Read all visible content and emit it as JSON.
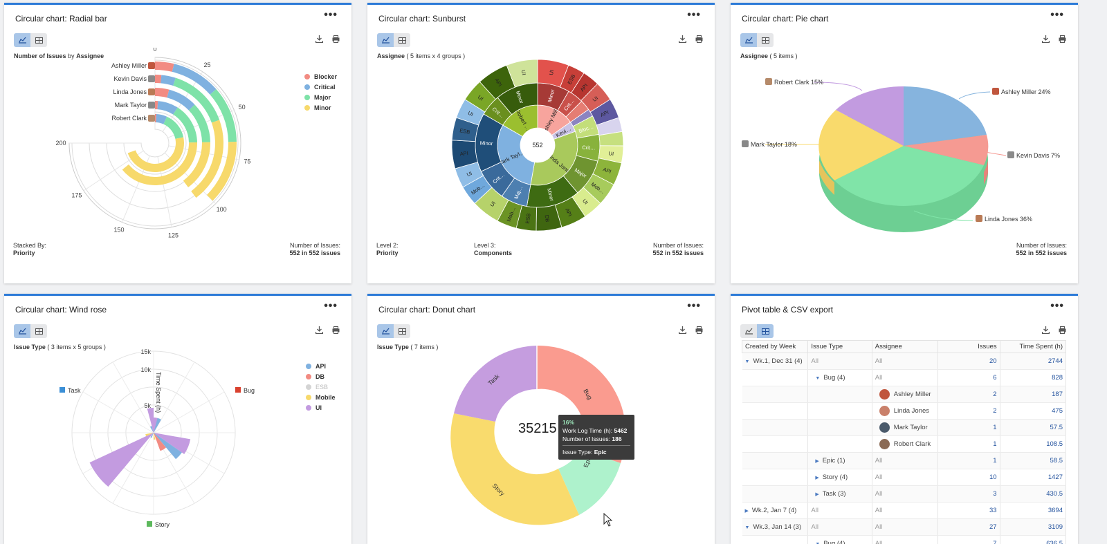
{
  "common": {
    "more": "•••"
  },
  "radial": {
    "title": "Circular chart: Radial bar",
    "subtitle_bold1": "Number of Issues",
    "subtitle_mid": "by",
    "subtitle_bold2": "Assignee",
    "footer_left_label": "Stacked By:",
    "footer_left_value": "Priority",
    "footer_right_label": "Number of Issues:",
    "footer_right_value": "552 in 552 issues",
    "ticks": [
      "0",
      "25",
      "50",
      "75",
      "100",
      "125",
      "150",
      "175",
      "200"
    ],
    "assignees": [
      "Ashley Miller",
      "Kevin Davis",
      "Linda Jones",
      "Mark Taylor",
      "Robert Clark"
    ],
    "legend": [
      {
        "label": "Blocker",
        "color": "#f28b82"
      },
      {
        "label": "Critical",
        "color": "#7fb1e0"
      },
      {
        "label": "Major",
        "color": "#7ee2a8"
      },
      {
        "label": "Minor",
        "color": "#f7d96b"
      }
    ]
  },
  "sunburst": {
    "title": "Circular chart: Sunburst",
    "subtitle_bold": "Assignee",
    "subtitle_rest": "( 5 items x 4 groups )",
    "center": "552",
    "footer1_label": "Level 2:",
    "footer1_value": "Priority",
    "footer2_label": "Level 3:",
    "footer2_value": "Components",
    "footer3_label": "Number of Issues:",
    "footer3_value": "552 in 552 issues",
    "inner": [
      {
        "label": "Ashley Miller",
        "color": "#f7a49d"
      },
      {
        "label": "Kevi…",
        "color": "#c9c3e6"
      },
      {
        "label": "Linda Jones",
        "color": "#a9c95c"
      },
      {
        "label": "Mark Tayl…",
        "color": "#7fb1e0"
      },
      {
        "label": "Robert …",
        "color": "#9bbf2f"
      }
    ],
    "middle": [
      {
        "label": "Minor",
        "color": "#a63a36"
      },
      {
        "label": "Crit…",
        "color": "#c9504a"
      },
      {
        "label": "Blo…",
        "color": "#e57d73"
      },
      {
        "label": "Min…",
        "color": "#8b84c0"
      },
      {
        "label": "Bloc…",
        "color": "#c3de7a"
      },
      {
        "label": "Crit…",
        "color": "#88b23c"
      },
      {
        "label": "Major",
        "color": "#6f9430"
      },
      {
        "label": "Minor",
        "color": "#3e6b12"
      },
      {
        "label": "Maj…",
        "color": "#4d7fb0"
      },
      {
        "label": "Crit…",
        "color": "#3a6a9b"
      },
      {
        "label": "Minor",
        "color": "#1f4e79"
      },
      {
        "label": "Crit…",
        "color": "#6a8f1e"
      },
      {
        "label": "Minor",
        "color": "#375c0c"
      }
    ],
    "outer": [
      {
        "label": "UI",
        "color": "#e2524c"
      },
      {
        "label": "ESB",
        "color": "#c73f38"
      },
      {
        "label": "API",
        "color": "#b73530"
      },
      {
        "label": "UI",
        "color": "#d65e57"
      },
      {
        "label": "API",
        "color": "#5d58a0"
      },
      {
        "label": "UI",
        "color": "#d8d4ee"
      },
      {
        "label": "ESB",
        "color": "#c6e07f"
      },
      {
        "label": "UI",
        "color": "#e1ef97"
      },
      {
        "label": "API",
        "color": "#8db43b"
      },
      {
        "label": "Mob…",
        "color": "#a7cb5c"
      },
      {
        "label": "UI",
        "color": "#d9ec8e"
      },
      {
        "label": "API",
        "color": "#557f17"
      },
      {
        "label": "DB",
        "color": "#3f6610"
      },
      {
        "label": "ESB",
        "color": "#4b7414"
      },
      {
        "label": "Mob…",
        "color": "#6b9325"
      },
      {
        "label": "UI",
        "color": "#b6d26a"
      },
      {
        "label": "Mob…",
        "color": "#6fa8dc"
      },
      {
        "label": "UI",
        "color": "#8fbde6"
      },
      {
        "label": "API",
        "color": "#1d4a74"
      },
      {
        "label": "ESB",
        "color": "#2f5f8c"
      },
      {
        "label": "UI",
        "color": "#8fbde6"
      },
      {
        "label": "UI",
        "color": "#7aa626"
      },
      {
        "label": "API",
        "color": "#3d640b"
      },
      {
        "label": "UI",
        "color": "#cfe39a"
      }
    ]
  },
  "pie": {
    "title": "Circular chart: Pie chart",
    "subtitle_bold": "Assignee",
    "subtitle_rest": "( 5 items )",
    "footer_label": "Number of Issues:",
    "footer_value": "552 in 552 issues",
    "labels": [
      {
        "text": "Ashley Miller 24%"
      },
      {
        "text": "Kevin Davis 7%"
      },
      {
        "text": "Linda Jones 36%"
      },
      {
        "text": "Mark Taylor 18%"
      },
      {
        "text": "Robert Clark 15%"
      }
    ]
  },
  "windrose": {
    "title": "Circular chart: Wind rose",
    "subtitle_bold": "Issue Type",
    "subtitle_rest": "( 3 items x 5 groups )",
    "ticks": [
      "15k",
      "10k",
      "5k"
    ],
    "axis_label": "Time Spent (h)",
    "dir_task": "Task",
    "dir_bug": "Bug",
    "dir_story": "Story",
    "legend": [
      {
        "label": "API",
        "color": "#7fb1e0"
      },
      {
        "label": "DB",
        "color": "#f28b82"
      },
      {
        "label": "ESB",
        "color": "#cfcfcf"
      },
      {
        "label": "Mobile",
        "color": "#f7d96b"
      },
      {
        "label": "UI",
        "color": "#c39be0"
      }
    ]
  },
  "donut": {
    "title": "Circular chart: Donut chart",
    "subtitle_bold": "Issue Type",
    "subtitle_rest": "( 7 items )",
    "center": "35215",
    "segments": [
      {
        "label": "Bug",
        "color": "#fa9b8f"
      },
      {
        "label": "Epic",
        "color": "#aef2cc"
      },
      {
        "label": "Story",
        "color": "#f9db6d"
      },
      {
        "label": "Task",
        "color": "#c59ddf"
      }
    ],
    "tooltip": {
      "pct": "16%",
      "l1_label": "Work Log Time (h):",
      "l1_value": "5462",
      "l2_label": "Number of Issues:",
      "l2_value": "186",
      "l3_label": "Issue Type:",
      "l3_value": "Epic"
    }
  },
  "pivot": {
    "title": "Pivot table & CSV export",
    "headers": [
      "Created by Week",
      "Issue Type",
      "Assignee",
      "Issues",
      "Time Spent (h)"
    ],
    "rows": [
      {
        "c1": "Wk.1, Dec 31 (4)",
        "c2": "All",
        "c3": "All",
        "issues": "20",
        "time": "2744",
        "c1caret": "▼"
      },
      {
        "c1": "",
        "c2": "Bug (4)",
        "c3": "All",
        "issues": "6",
        "time": "828",
        "c2caret": "▼"
      },
      {
        "c1": "",
        "c2": "",
        "c3": "Ashley Miller",
        "issues": "2",
        "time": "187",
        "avatar": "#c0563d"
      },
      {
        "c1": "",
        "c2": "",
        "c3": "Linda Jones",
        "issues": "2",
        "time": "475",
        "avatar": "#c9806a"
      },
      {
        "c1": "",
        "c2": "",
        "c3": "Mark Taylor",
        "issues": "1",
        "time": "57.5",
        "avatar": "#4a5a6b"
      },
      {
        "c1": "",
        "c2": "",
        "c3": "Robert Clark",
        "issues": "1",
        "time": "108.5",
        "avatar": "#8a6a55"
      },
      {
        "c1": "",
        "c2": "Epic (1)",
        "c3": "All",
        "issues": "1",
        "time": "58.5",
        "c2caret": "▶"
      },
      {
        "c1": "",
        "c2": "Story (4)",
        "c3": "All",
        "issues": "10",
        "time": "1427",
        "c2caret": "▶"
      },
      {
        "c1": "",
        "c2": "Task (3)",
        "c3": "All",
        "issues": "3",
        "time": "430.5",
        "c2caret": "▶"
      },
      {
        "c1": "Wk.2, Jan 7 (4)",
        "c2": "All",
        "c3": "All",
        "issues": "33",
        "time": "3694",
        "c1caret": "▶"
      },
      {
        "c1": "Wk.3, Jan 14 (3)",
        "c2": "All",
        "c3": "All",
        "issues": "27",
        "time": "3109",
        "c1caret": "▼"
      },
      {
        "c1": "",
        "c2": "Bug (4)",
        "c3": "All",
        "issues": "7",
        "time": "636.5",
        "c2caret": "▼"
      }
    ]
  }
}
